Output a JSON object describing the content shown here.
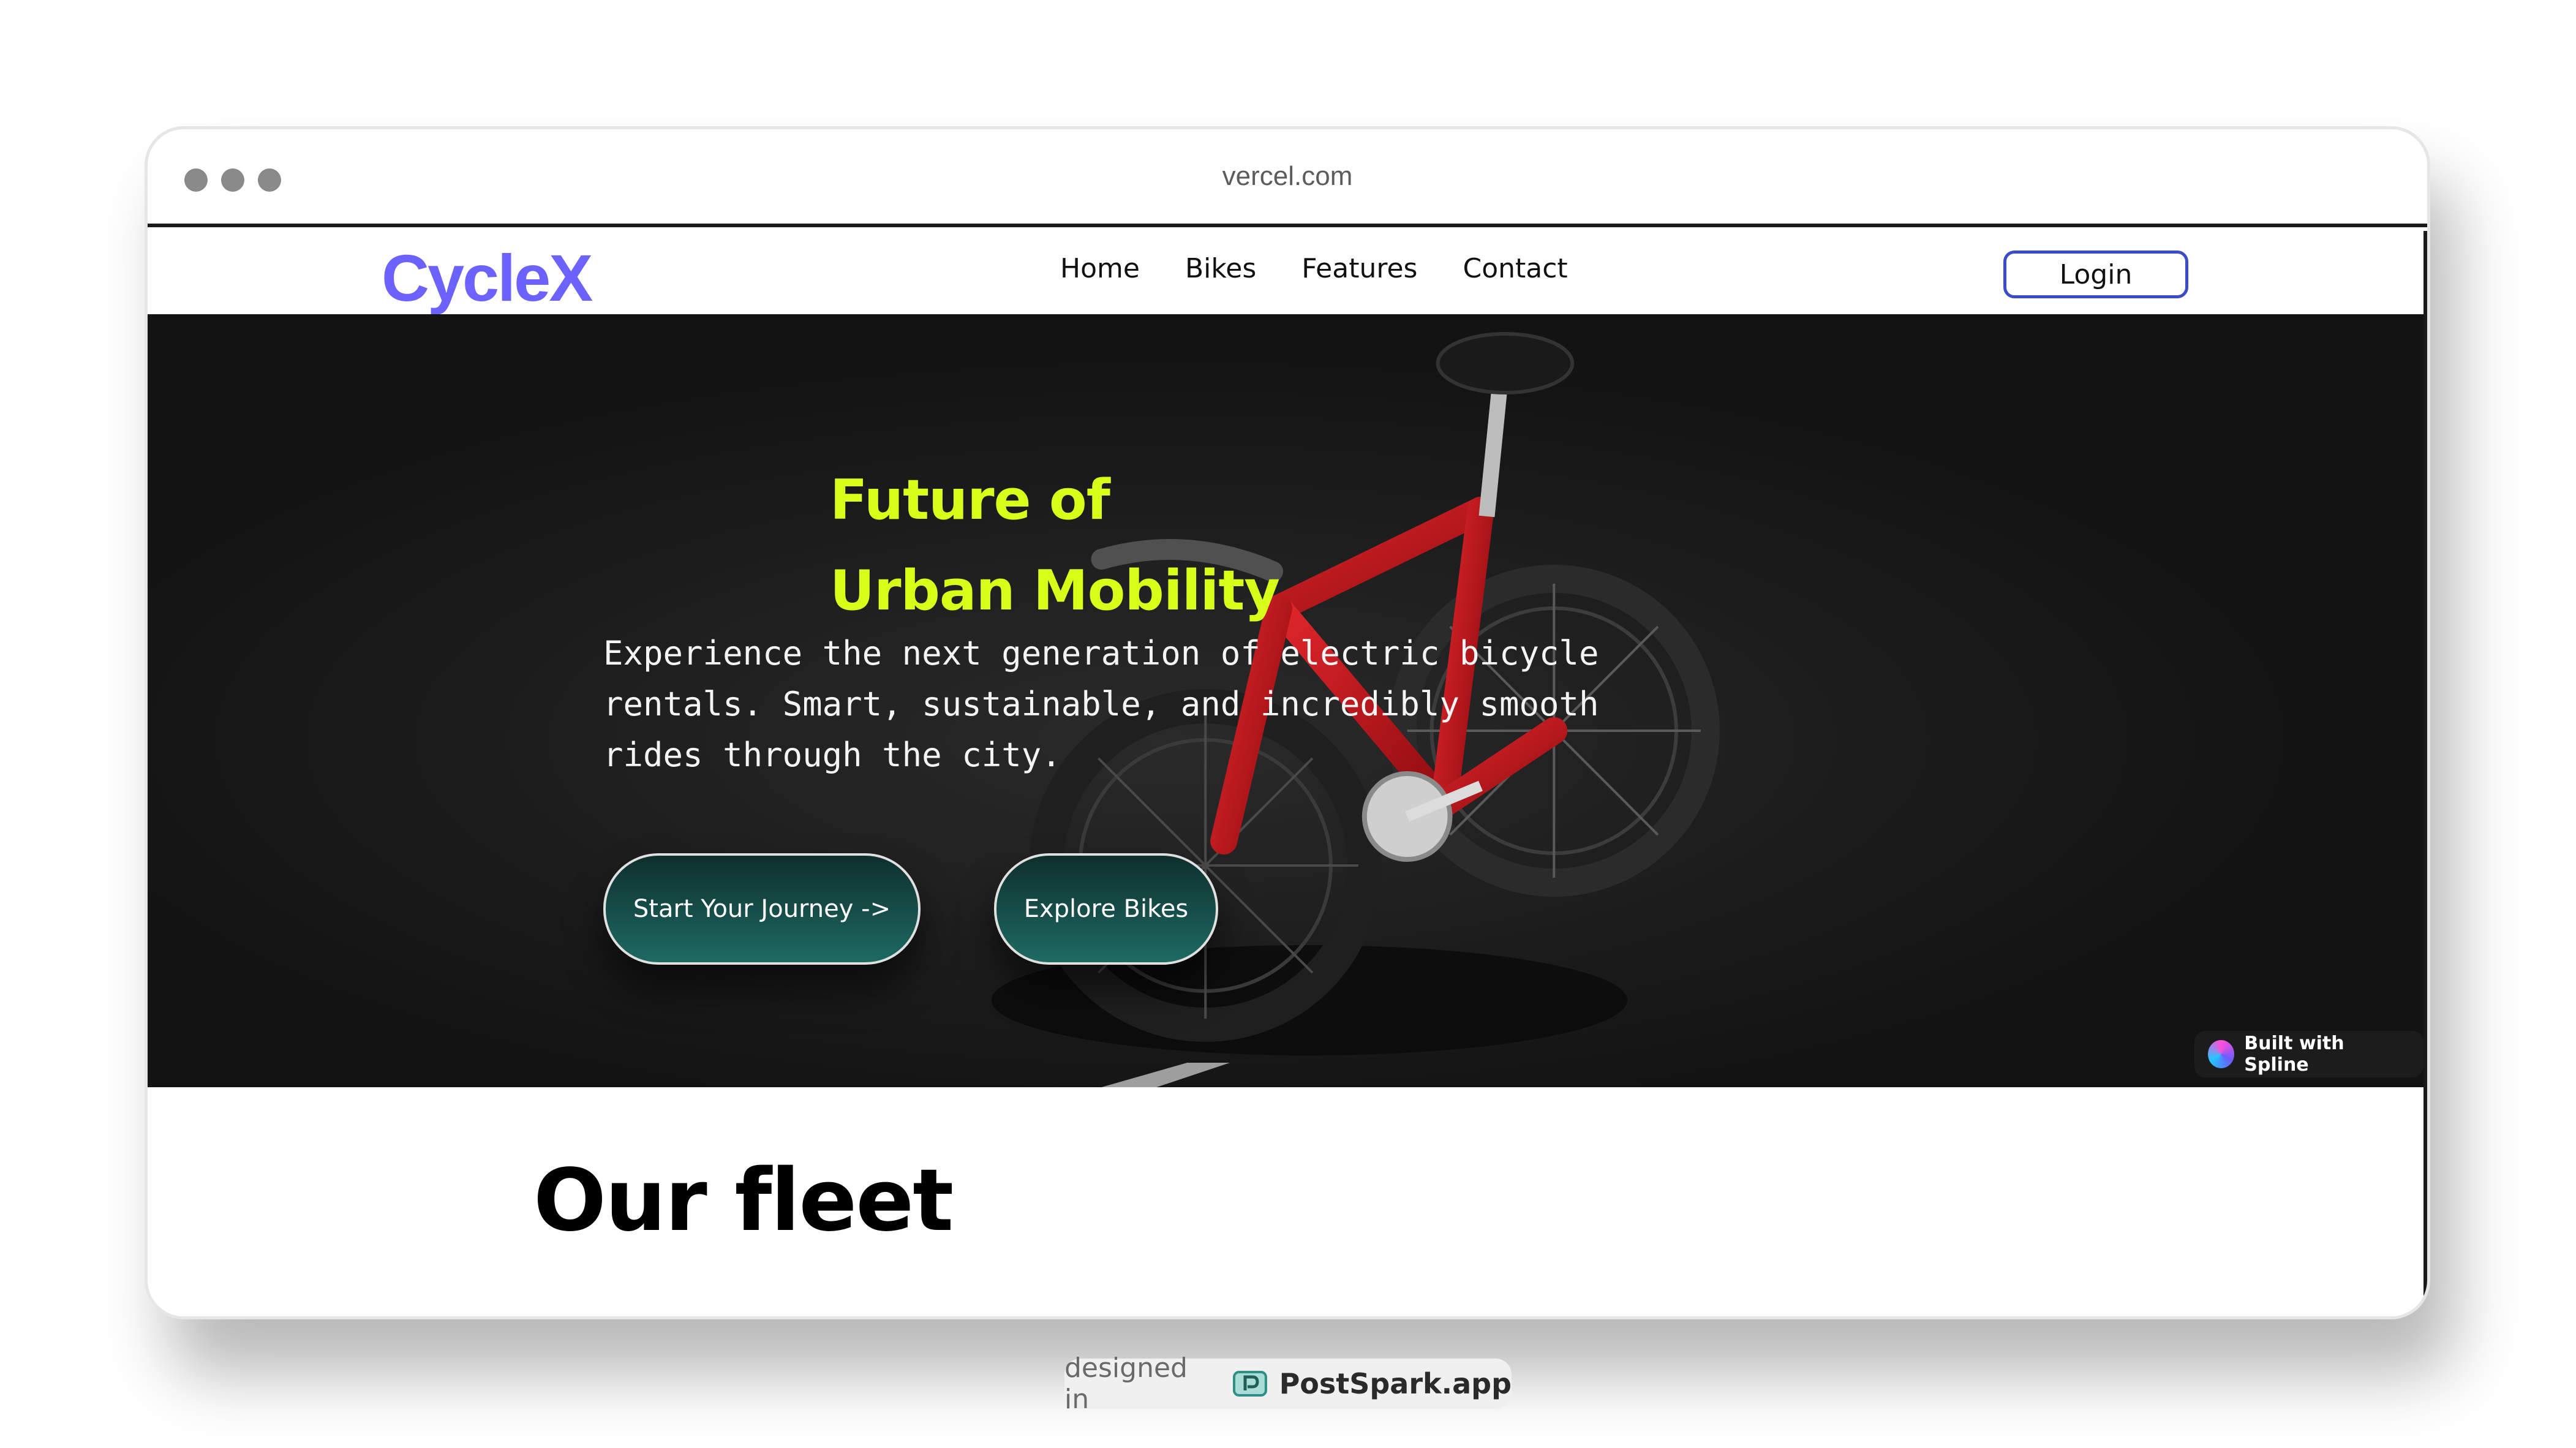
{
  "browser": {
    "url": "vercel.com"
  },
  "navbar": {
    "logo": "CycleX",
    "links": [
      "Home",
      "Bikes",
      "Features",
      "Contact"
    ],
    "login_label": "Login"
  },
  "hero": {
    "headline_line1": "Future of",
    "headline_line2": "Urban Mobility",
    "subtext": "Experience the next generation of electric bicycle\nrentals. Smart, sustainable, and incredibly smooth\nrides through the city.",
    "primary_cta": "Start Your Journey ->",
    "secondary_cta": "Explore Bikes",
    "spline_badge": "Built with Spline"
  },
  "fleet": {
    "title": "Our fleet"
  },
  "footer": {
    "designed_in": "designed in",
    "brand": "PostSpark.app"
  },
  "colors": {
    "logo": "#6c63ff",
    "headline": "#d7ff1a",
    "hero_bg": "#131313",
    "cta_gradient_top": "#0e2f2d",
    "cta_gradient_bottom": "#1e6a63",
    "login_border": "#3b4cca",
    "bike_frame": "#c8161b"
  }
}
